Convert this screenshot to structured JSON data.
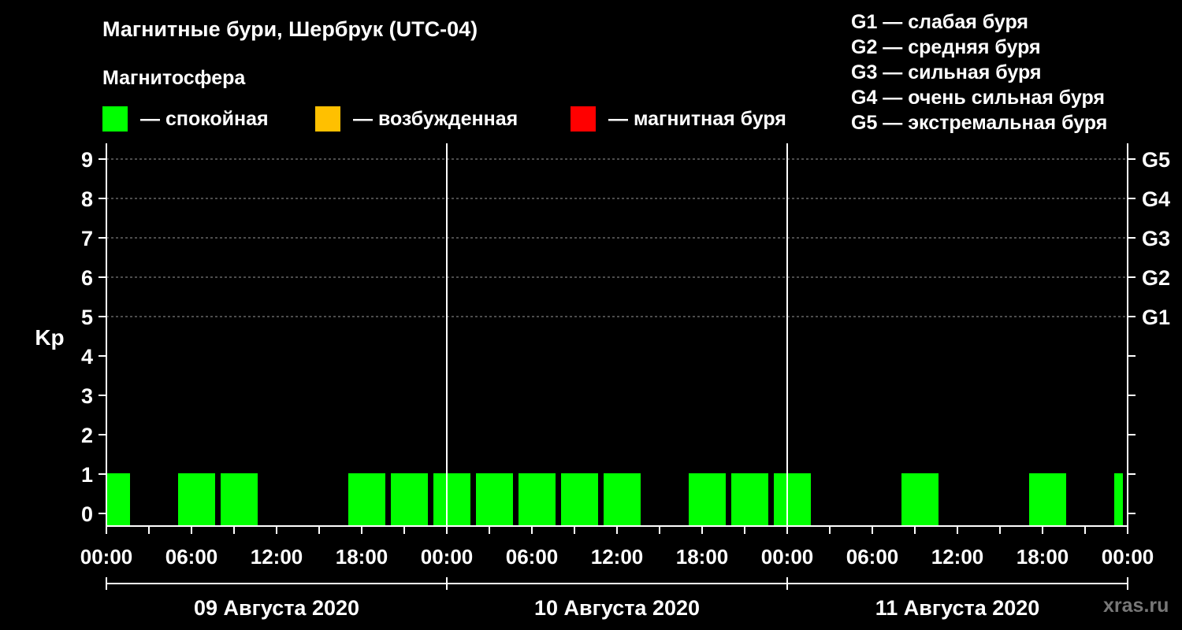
{
  "title": "Магнитные бури, Шербрук (UTC-04)",
  "subtitle": "Магнитосфера",
  "legend": [
    {
      "label": "— спокойная",
      "color": "#00ff00"
    },
    {
      "label": "— возбужденная",
      "color": "#ffc000"
    },
    {
      "label": "— магнитная буря",
      "color": "#ff0000"
    }
  ],
  "g_scale": [
    "G1 — слабая буря",
    "G2 — средняя буря",
    "G3 — сильная буря",
    "G4 — очень сильная буря",
    "G5 — экстремальная буря"
  ],
  "watermark": "xras.ru",
  "chart_data": {
    "type": "bar",
    "ylabel": "Kp",
    "ylim": [
      0,
      9
    ],
    "yticks": [
      "0",
      "1",
      "2",
      "3",
      "4",
      "5",
      "6",
      "7",
      "8",
      "9"
    ],
    "right_ticks": [
      {
        "kp": 5,
        "label": "G1"
      },
      {
        "kp": 6,
        "label": "G2"
      },
      {
        "kp": 7,
        "label": "G3"
      },
      {
        "kp": 8,
        "label": "G4"
      },
      {
        "kp": 9,
        "label": "G5"
      }
    ],
    "x_hours_range": [
      0,
      72
    ],
    "xtick_labels": [
      "00:00",
      "06:00",
      "12:00",
      "18:00",
      "00:00",
      "06:00",
      "12:00",
      "18:00",
      "00:00",
      "06:00",
      "12:00",
      "18:00",
      "00:00"
    ],
    "days": [
      "09 Августа 2020",
      "10 Августа 2020",
      "11 Августа 2020"
    ],
    "grid_kp": [
      5,
      6,
      7,
      8,
      9
    ],
    "bar_color": "#00ff00",
    "bars": [
      {
        "start_hour": 0,
        "end_hour": 2,
        "kp": 1
      },
      {
        "start_hour": 5,
        "end_hour": 8,
        "kp": 1
      },
      {
        "start_hour": 8,
        "end_hour": 11,
        "kp": 1
      },
      {
        "start_hour": 17,
        "end_hour": 20,
        "kp": 1
      },
      {
        "start_hour": 20,
        "end_hour": 23,
        "kp": 1
      },
      {
        "start_hour": 23,
        "end_hour": 26,
        "kp": 1
      },
      {
        "start_hour": 26,
        "end_hour": 29,
        "kp": 1
      },
      {
        "start_hour": 29,
        "end_hour": 32,
        "kp": 1
      },
      {
        "start_hour": 32,
        "end_hour": 35,
        "kp": 1
      },
      {
        "start_hour": 35,
        "end_hour": 38,
        "kp": 1
      },
      {
        "start_hour": 41,
        "end_hour": 44,
        "kp": 1
      },
      {
        "start_hour": 44,
        "end_hour": 47,
        "kp": 1
      },
      {
        "start_hour": 47,
        "end_hour": 50,
        "kp": 1
      },
      {
        "start_hour": 56,
        "end_hour": 59,
        "kp": 1
      },
      {
        "start_hour": 65,
        "end_hour": 68,
        "kp": 1
      },
      {
        "start_hour": 71,
        "end_hour": 72,
        "kp": 1
      }
    ]
  }
}
